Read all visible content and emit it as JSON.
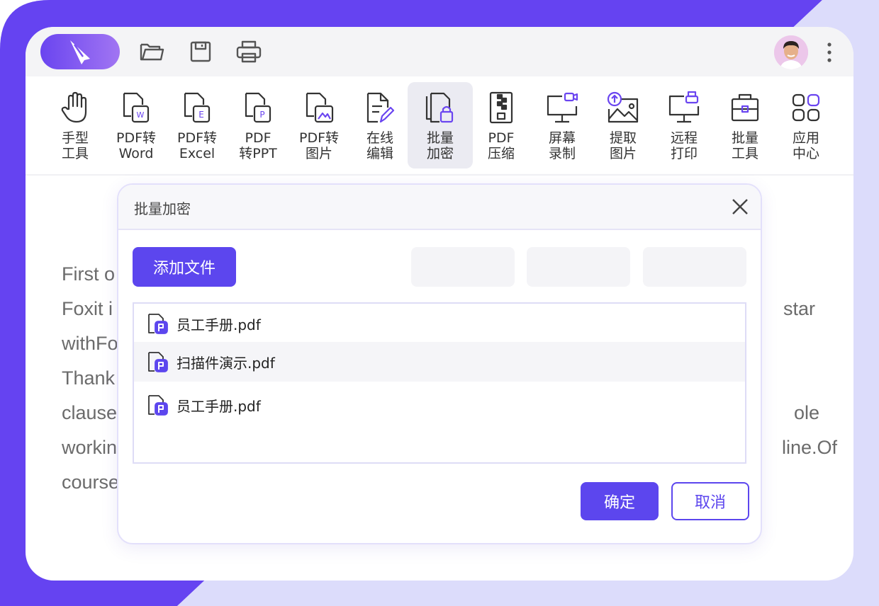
{
  "theme": {
    "accent": "#5c46ee",
    "frame": "#6a45f0",
    "frame_light": "#dcdcfb"
  },
  "titlebar": {
    "icons": [
      "app-logo-icon",
      "folder-open-icon",
      "save-icon",
      "printer-icon",
      "more-vertical-icon"
    ]
  },
  "ribbon": {
    "tools": [
      {
        "label": "手型\n工具",
        "icon": "hand-icon"
      },
      {
        "label": "PDF转\nWord",
        "icon": "pdf-to-word-icon"
      },
      {
        "label": "PDF转\nExcel",
        "icon": "pdf-to-excel-icon"
      },
      {
        "label": "PDF\n转PPT",
        "icon": "pdf-to-ppt-icon"
      },
      {
        "label": "PDF转\n图片",
        "icon": "pdf-to-image-icon"
      },
      {
        "label": "在线\n编辑",
        "icon": "online-edit-icon"
      },
      {
        "label": "批量\n加密",
        "icon": "batch-encrypt-icon",
        "active": true
      },
      {
        "label": "PDF\n压缩",
        "icon": "pdf-compress-icon"
      },
      {
        "label": "屏幕\n录制",
        "icon": "screen-record-icon"
      },
      {
        "label": "提取\n图片",
        "icon": "extract-image-icon"
      },
      {
        "label": "远程\n打印",
        "icon": "remote-print-icon"
      },
      {
        "label": "批量\n工具",
        "icon": "batch-tools-icon"
      },
      {
        "label": "应用\n中心",
        "icon": "app-center-icon"
      }
    ]
  },
  "document": {
    "lines_left": [
      "First o",
      "Foxit i",
      "withFo",
      "Thank",
      "clause",
      "workin",
      "course"
    ],
    "lines_right": [
      "",
      "star",
      "",
      "",
      "ole",
      "line.Of",
      ""
    ]
  },
  "modal": {
    "title": "批量加密",
    "add_button": "添加文件",
    "files": [
      {
        "name": "员工手册.pdf"
      },
      {
        "name": "扫描件演示.pdf",
        "highlighted": true
      },
      {
        "name": "员工手册.pdf"
      }
    ],
    "ok_button": "确定",
    "cancel_button": "取消"
  }
}
